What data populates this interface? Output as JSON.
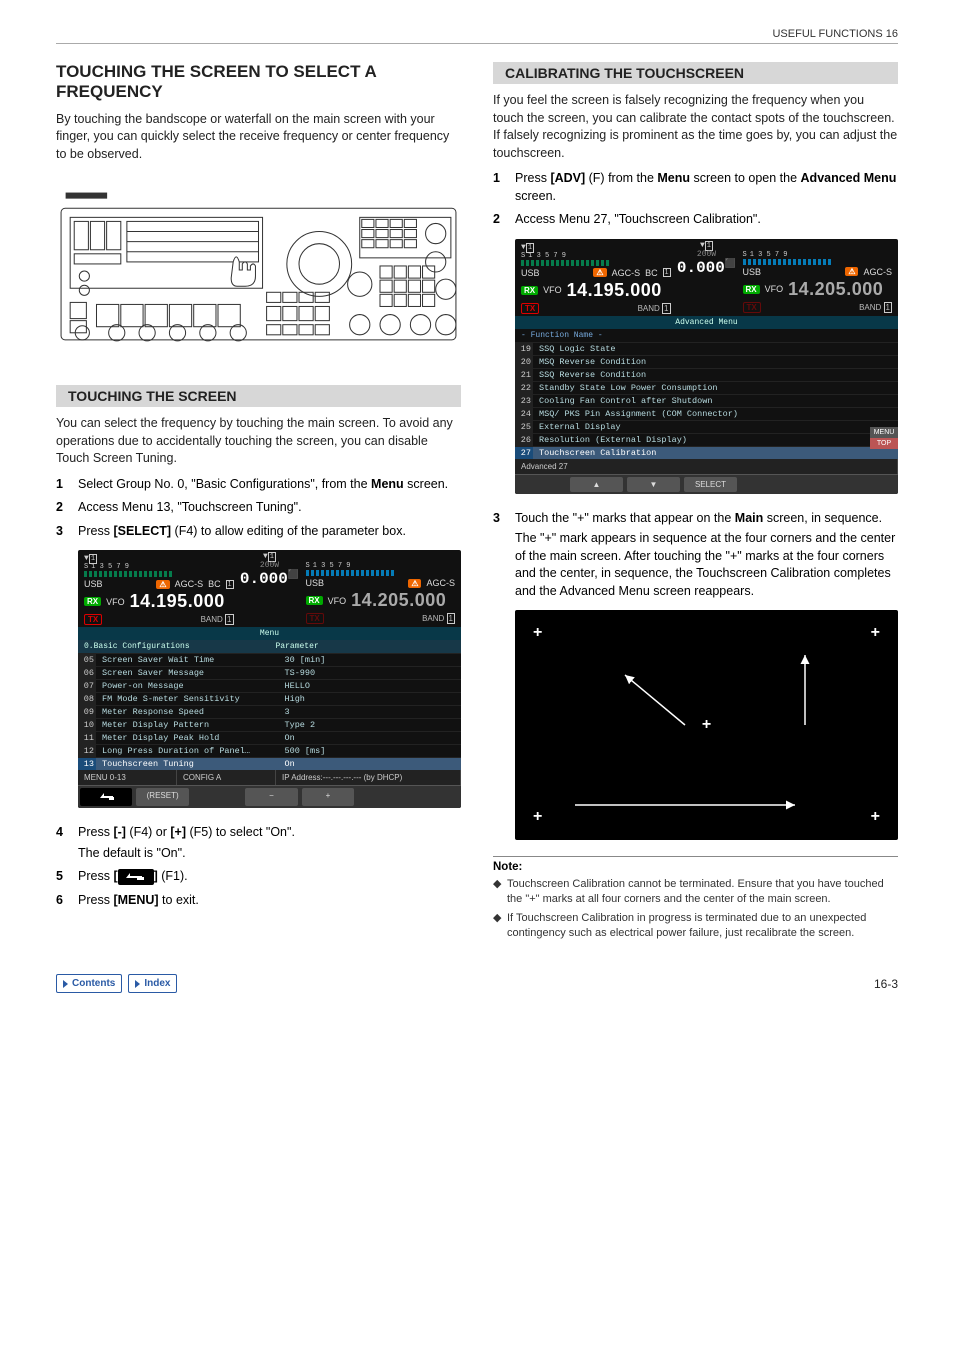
{
  "header": {
    "section_label": "USEFUL FUNCTIONS 16"
  },
  "left": {
    "title": "TOUCHING THE SCREEN TO SELECT A FREQUENCY",
    "intro": "By touching the bandscope or waterfall on the main screen with your finger, you can quickly select the receive frequency or center frequency to be observed.",
    "sub1_title": "TOUCHING THE SCREEN",
    "sub1_body": "You can select the frequency by touching the main screen. To avoid any operations due to accidentally touching the screen, you can disable Touch Screen Tuning.",
    "steps_a": [
      {
        "n": "1",
        "text_pre": "Select Group No. 0, \"Basic Configurations\", from the ",
        "bold1": "Menu",
        "text_post": " screen."
      },
      {
        "n": "2",
        "text_pre": "Access Menu 13, \"Touchscreen Tuning\".",
        "bold1": "",
        "text_post": ""
      },
      {
        "n": "3",
        "text_pre": "Press ",
        "bold1": "[SELECT]",
        "text_post": " (F4) to allow editing of the parameter box."
      }
    ],
    "steps_b": [
      {
        "n": "4",
        "text_pre": "Press ",
        "bold1": "[-]",
        "mid": " (F4) or ",
        "bold2": "[+]",
        "text_post": " (F5) to select \"On\".",
        "sub": "The default is \"On\"."
      },
      {
        "n": "5",
        "text_pre": "Press ",
        "bold1": "[",
        "icon": true,
        "bold2": "]",
        "text_post": " (F1)."
      },
      {
        "n": "6",
        "text_pre": "Press ",
        "bold1": "[MENU]",
        "text_post": " to exit."
      }
    ],
    "menu1": {
      "power_label": "200W",
      "power_value": "0.000",
      "usb": "USB",
      "agc": "AGC-S",
      "bc": "BC",
      "vfo": "VFO",
      "freq_main": "14.195.000",
      "freq_sub": "14.205.000",
      "band": "BAND",
      "bandnum": "1",
      "titlebar": "Menu",
      "header_left": "0.Basic Configurations",
      "header_right": "Parameter",
      "rows": [
        {
          "n": "05",
          "label": "Screen Saver Wait Time",
          "val": "30 [min]"
        },
        {
          "n": "06",
          "label": "Screen Saver Message",
          "val": "TS-990"
        },
        {
          "n": "07",
          "label": "Power-on Message",
          "val": "HELLO"
        },
        {
          "n": "08",
          "label": "FM Mode S-meter Sensitivity",
          "val": "High"
        },
        {
          "n": "09",
          "label": "Meter Response Speed",
          "val": "3"
        },
        {
          "n": "10",
          "label": "Meter Display Pattern",
          "val": "Type 2"
        },
        {
          "n": "11",
          "label": "Meter Display Peak Hold",
          "val": "On"
        },
        {
          "n": "12",
          "label": "Long Press Duration of Panel…",
          "val": "500 [ms]"
        },
        {
          "n": "13",
          "label": "Touchscreen Tuning",
          "val": "On",
          "selected": true
        }
      ],
      "status_left": "MENU 0-13",
      "status_mid": "CONFIG A",
      "status_right": "IP Address:---.---.---.--- (by DHCP)",
      "footer": [
        "",
        "(RESET)",
        "",
        "−",
        "+",
        "",
        ""
      ]
    }
  },
  "right": {
    "sub_title": "CALIBRATING THE TOUCHSCREEN",
    "body": "If you feel the screen is falsely recognizing the frequency when you touch the screen, you can calibrate the contact spots of the touchscreen. If falsely recognizing is prominent as the time goes by, you can adjust the touchscreen.",
    "steps_a": [
      {
        "n": "1",
        "text_pre": "Press ",
        "bold1": "[ADV]",
        "mid": " (F) from the ",
        "bold2": "Menu",
        "text_post": " screen to open the ",
        "bold3": "Advanced Menu",
        "tail": " screen."
      },
      {
        "n": "2",
        "text_pre": "Access Menu 27, \"Touchscreen Calibration\"."
      }
    ],
    "menu2": {
      "power_label": "200W",
      "power_value": "0.000",
      "usb": "USB",
      "agc": "AGC-S",
      "bc": "BC",
      "vfo": "VFO",
      "freq_main": "14.195.000",
      "freq_sub": "14.205.000",
      "band": "BAND",
      "bandnum": "1",
      "titlebar": "Advanced Menu",
      "subtitle": "- Function Name -",
      "rows": [
        {
          "n": "19",
          "label": "SSQ Logic State"
        },
        {
          "n": "20",
          "label": "MSQ Reverse Condition"
        },
        {
          "n": "21",
          "label": "SSQ Reverse Condition"
        },
        {
          "n": "22",
          "label": "Standby State Low Power Consumption"
        },
        {
          "n": "23",
          "label": "Cooling Fan Control after Shutdown"
        },
        {
          "n": "24",
          "label": "MSQ/ PKS Pin Assignment (COM Connector)"
        },
        {
          "n": "25",
          "label": "External Display"
        },
        {
          "n": "26",
          "label": "Resolution (External Display)"
        },
        {
          "n": "27",
          "label": "Touchscreen Calibration",
          "selected": true
        }
      ],
      "status_left": "Advanced 27",
      "footer_up": "▲",
      "footer_down": "▼",
      "footer_select": "SELECT",
      "side1": "MENU",
      "side2": "TOP"
    },
    "step3_n": "3",
    "step3_pre": "Touch the \"+\" marks that appear on the ",
    "step3_bold": "Main",
    "step3_post": " screen, in sequence.",
    "step3_sub": "The \"+\" mark appears in sequence at the four corners and the center of the main screen. After touching the \"+\" marks at the four corners and the center, in sequence, the Touchscreen Calibration completes and the Advanced Menu screen reappears.",
    "note_title": "Note:",
    "notes": [
      "Touchscreen Calibration cannot be terminated. Ensure that you have touched the \"+\" marks at all four corners and the center of the main screen.",
      "If Touchscreen Calibration in progress is terminated due to an unexpected contingency such as electrical power failure, just recalibrate the screen."
    ]
  },
  "footer": {
    "contents": "Contents",
    "index": "Index",
    "page": "16-3"
  }
}
